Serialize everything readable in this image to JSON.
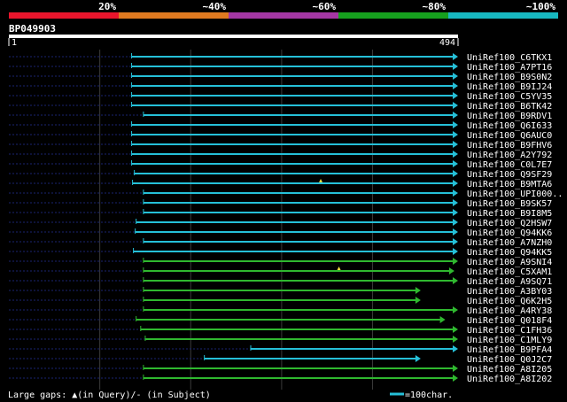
{
  "header": {
    "scale_labels": [
      "20%",
      "~40%",
      "~60%",
      "~80%",
      "~100%"
    ],
    "scale_colors": [
      "#e8152c",
      "#e07a20",
      "#a437a4",
      "#16a01e",
      "#17b8c0"
    ],
    "query_name": "BP049903",
    "ruler_start": "1",
    "ruler_end": "494"
  },
  "query_length": 494,
  "hits": [
    {
      "name": "UniRef100_C6TKX1",
      "start": 135,
      "end": 494,
      "color": "#25c0d8",
      "arrow": true
    },
    {
      "name": "UniRef100_A7PT16",
      "start": 135,
      "end": 494,
      "color": "#25c0d8",
      "arrow": true
    },
    {
      "name": "UniRef100_B9S0N2",
      "start": 135,
      "end": 494,
      "color": "#25c0d8",
      "arrow": true
    },
    {
      "name": "UniRef100_B9IJ24",
      "start": 135,
      "end": 494,
      "color": "#25c0d8",
      "arrow": true
    },
    {
      "name": "UniRef100_C5YV35",
      "start": 135,
      "end": 494,
      "color": "#25c0d8",
      "arrow": true
    },
    {
      "name": "UniRef100_B6TK42",
      "start": 135,
      "end": 494,
      "color": "#25c0d8",
      "arrow": true
    },
    {
      "name": "UniRef100_B9RDV1",
      "start": 148,
      "end": 494,
      "color": "#25c0d8",
      "arrow": true
    },
    {
      "name": "UniRef100_Q6I633",
      "start": 135,
      "end": 494,
      "color": "#25c0d8",
      "arrow": true
    },
    {
      "name": "UniRef100_Q6AUC0",
      "start": 135,
      "end": 494,
      "color": "#25c0d8",
      "arrow": true
    },
    {
      "name": "UniRef100_B9FHV6",
      "start": 135,
      "end": 494,
      "color": "#25c0d8",
      "arrow": true
    },
    {
      "name": "UniRef100_A2Y792",
      "start": 135,
      "end": 494,
      "color": "#25c0d8",
      "arrow": true
    },
    {
      "name": "UniRef100_C0L7E7",
      "start": 135,
      "end": 494,
      "color": "#25c0d8",
      "arrow": true
    },
    {
      "name": "UniRef100_Q9SF29",
      "start": 138,
      "end": 494,
      "color": "#25c0d8",
      "arrow": true
    },
    {
      "name": "UniRef100_B9MTA6",
      "start": 136,
      "end": 494,
      "color": "#25c0d8",
      "arrow": true,
      "gap_at": 343
    },
    {
      "name": "UniRef100_UPI000..",
      "start": 148,
      "end": 494,
      "color": "#25c0d8",
      "arrow": true
    },
    {
      "name": "UniRef100_B9SK57",
      "start": 148,
      "end": 494,
      "color": "#25c0d8",
      "arrow": true
    },
    {
      "name": "UniRef100_B9I8M5",
      "start": 148,
      "end": 494,
      "color": "#25c0d8",
      "arrow": true
    },
    {
      "name": "UniRef100_Q2HSW7",
      "start": 140,
      "end": 494,
      "color": "#25c0d8",
      "arrow": true
    },
    {
      "name": "UniRef100_Q94KK6",
      "start": 139,
      "end": 494,
      "color": "#25c0d8",
      "arrow": true
    },
    {
      "name": "UniRef100_A7NZH0",
      "start": 148,
      "end": 494,
      "color": "#25c0d8",
      "arrow": true
    },
    {
      "name": "UniRef100_Q94KK5",
      "start": 137,
      "end": 494,
      "color": "#25c0d8",
      "arrow": true
    },
    {
      "name": "UniRef100_A9SNI4",
      "start": 148,
      "end": 494,
      "color": "#2fb82f",
      "arrow": true
    },
    {
      "name": "UniRef100_C5XAM1",
      "start": 148,
      "end": 490,
      "color": "#2fb82f",
      "arrow": true,
      "gap_at": 363
    },
    {
      "name": "UniRef100_A9SQ71",
      "start": 148,
      "end": 494,
      "color": "#2fb82f",
      "arrow": true
    },
    {
      "name": "UniRef100_A3BY03",
      "start": 148,
      "end": 453,
      "color": "#2fb82f",
      "arrow": true
    },
    {
      "name": "UniRef100_Q6K2H5",
      "start": 148,
      "end": 453,
      "color": "#2fb82f",
      "arrow": true
    },
    {
      "name": "UniRef100_A4RY38",
      "start": 148,
      "end": 494,
      "color": "#2fb82f",
      "arrow": true
    },
    {
      "name": "UniRef100_Q018F4",
      "start": 140,
      "end": 480,
      "color": "#2fb82f",
      "arrow": true
    },
    {
      "name": "UniRef100_C1FH36",
      "start": 145,
      "end": 494,
      "color": "#2fb82f",
      "arrow": true
    },
    {
      "name": "UniRef100_C1MLY9",
      "start": 150,
      "end": 494,
      "color": "#2fb82f",
      "arrow": true
    },
    {
      "name": "UniRef100_B9PFA4",
      "start": 266,
      "end": 494,
      "color": "#25c0d8",
      "arrow": true
    },
    {
      "name": "UniRef100_Q0J2C7",
      "start": 215,
      "end": 453,
      "color": "#25c0d8",
      "arrow": true
    },
    {
      "name": "UniRef100_A8I205",
      "start": 148,
      "end": 494,
      "color": "#2fb82f",
      "arrow": true
    },
    {
      "name": "UniRef100_A8I202",
      "start": 148,
      "end": 494,
      "color": "#2fb82f",
      "arrow": true
    }
  ],
  "footer": {
    "legend_gaps": "Large gaps: ▲(in Query)/- (in Subject)",
    "legend_scale": "=100char."
  }
}
